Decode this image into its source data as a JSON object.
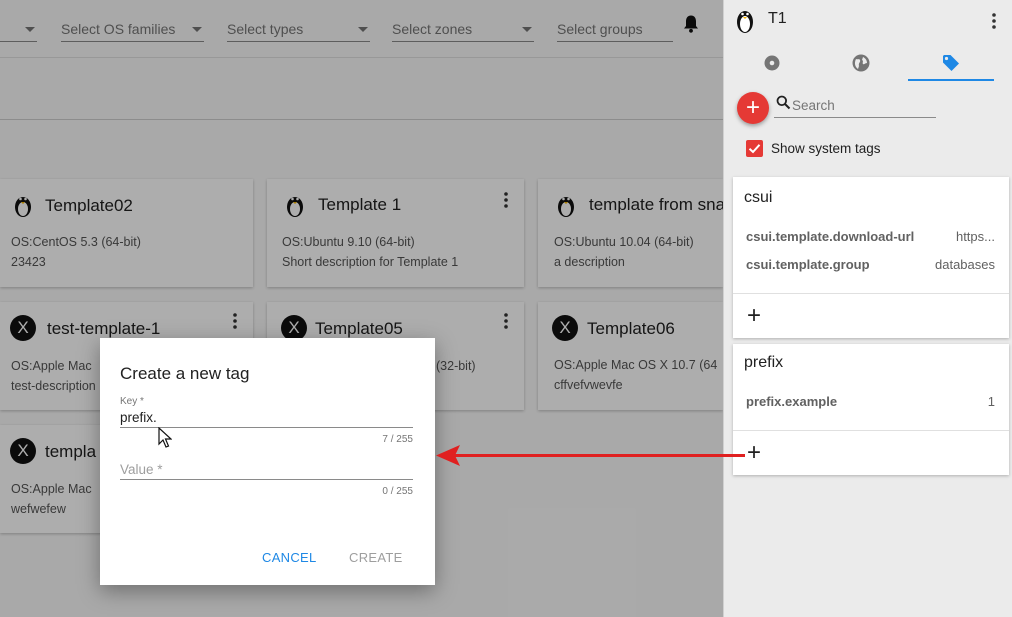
{
  "filters": {
    "first_placeholder": "",
    "os_families": "Select OS families",
    "types": "Select types",
    "zones": "Select zones",
    "groups": "Select groups"
  },
  "cards": [
    {
      "title": "Template02",
      "os": "OS:CentOS 5.3 (64-bit)",
      "desc": "23423",
      "icon": "linux-icon"
    },
    {
      "title": "Template 1",
      "os": "OS:Ubuntu 9.10 (64-bit)",
      "desc": "Short description for Template 1",
      "icon": "linux-icon"
    },
    {
      "title": "template from sna",
      "os": "OS:Ubuntu 10.04 (64-bit)",
      "desc": "a description",
      "icon": "linux-icon"
    },
    {
      "title": "test-template-1",
      "os": "OS:Apple Mac",
      "desc": "test-description",
      "icon": "macos-x-icon"
    },
    {
      "title": "Template05",
      "os": "(32-bit)",
      "desc": "",
      "icon": "macos-x-icon"
    },
    {
      "title": "Template06",
      "os": "OS:Apple Mac OS X 10.7 (64",
      "desc": "cffvefvwevfe",
      "icon": "macos-x-icon"
    },
    {
      "title": "templa",
      "os": "OS:Apple Mac",
      "desc": "wefwefew",
      "icon": "macos-x-icon"
    }
  ],
  "sidebar": {
    "title": "T1",
    "search_placeholder": "Search",
    "show_system_tags": "Show system tags",
    "tag_groups": [
      {
        "name": "csui",
        "tags": [
          {
            "key": "csui.template.download-url",
            "value": "https..."
          },
          {
            "key": "csui.template.group",
            "value": "databases"
          }
        ],
        "add": "+"
      },
      {
        "name": "prefix",
        "tags": [
          {
            "key": "prefix.example",
            "value": "1"
          }
        ],
        "add": "+"
      }
    ]
  },
  "dialog": {
    "title": "Create a new tag",
    "key_label": "Key *",
    "key_value": "prefix.",
    "key_counter": "7 / 255",
    "value_placeholder": "Value *",
    "value_counter": "0 / 255",
    "cancel": "CANCEL",
    "create": "CREATE"
  },
  "colors": {
    "accent": "#1e88e5",
    "fab": "#e53935",
    "arrow": "#e02020"
  }
}
